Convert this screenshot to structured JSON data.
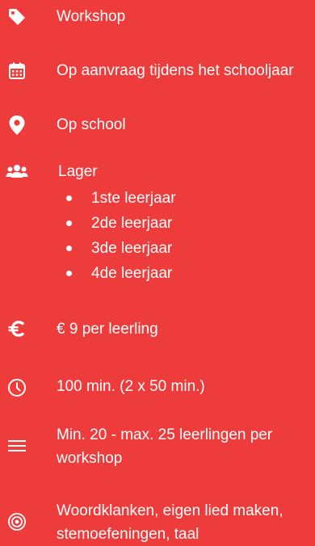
{
  "colors": {
    "background": "#EE3B3B",
    "text": "#FFFFFF"
  },
  "items": [
    {
      "icon": "tag-icon",
      "text": "Workshop"
    },
    {
      "icon": "calendar-icon",
      "text": "Op aanvraag tijdens het schooljaar"
    },
    {
      "icon": "map-pin-icon",
      "text": "Op school"
    },
    {
      "icon": "users-icon",
      "text": "Lager",
      "sub_items": [
        "1ste leerjaar",
        "2de leerjaar",
        "3de leerjaar",
        "4de leerjaar"
      ]
    },
    {
      "icon": "euro-icon",
      "text": "€ 9 per leerling"
    },
    {
      "icon": "clock-icon",
      "text": "100 min. (2 x 50 min.)"
    },
    {
      "icon": "menu-lines-icon",
      "text": "Min. 20 - max. 25 leerlingen per workshop"
    },
    {
      "icon": "target-icon",
      "text": "Woordklanken, eigen lied maken, stemoefeningen, taal"
    }
  ]
}
